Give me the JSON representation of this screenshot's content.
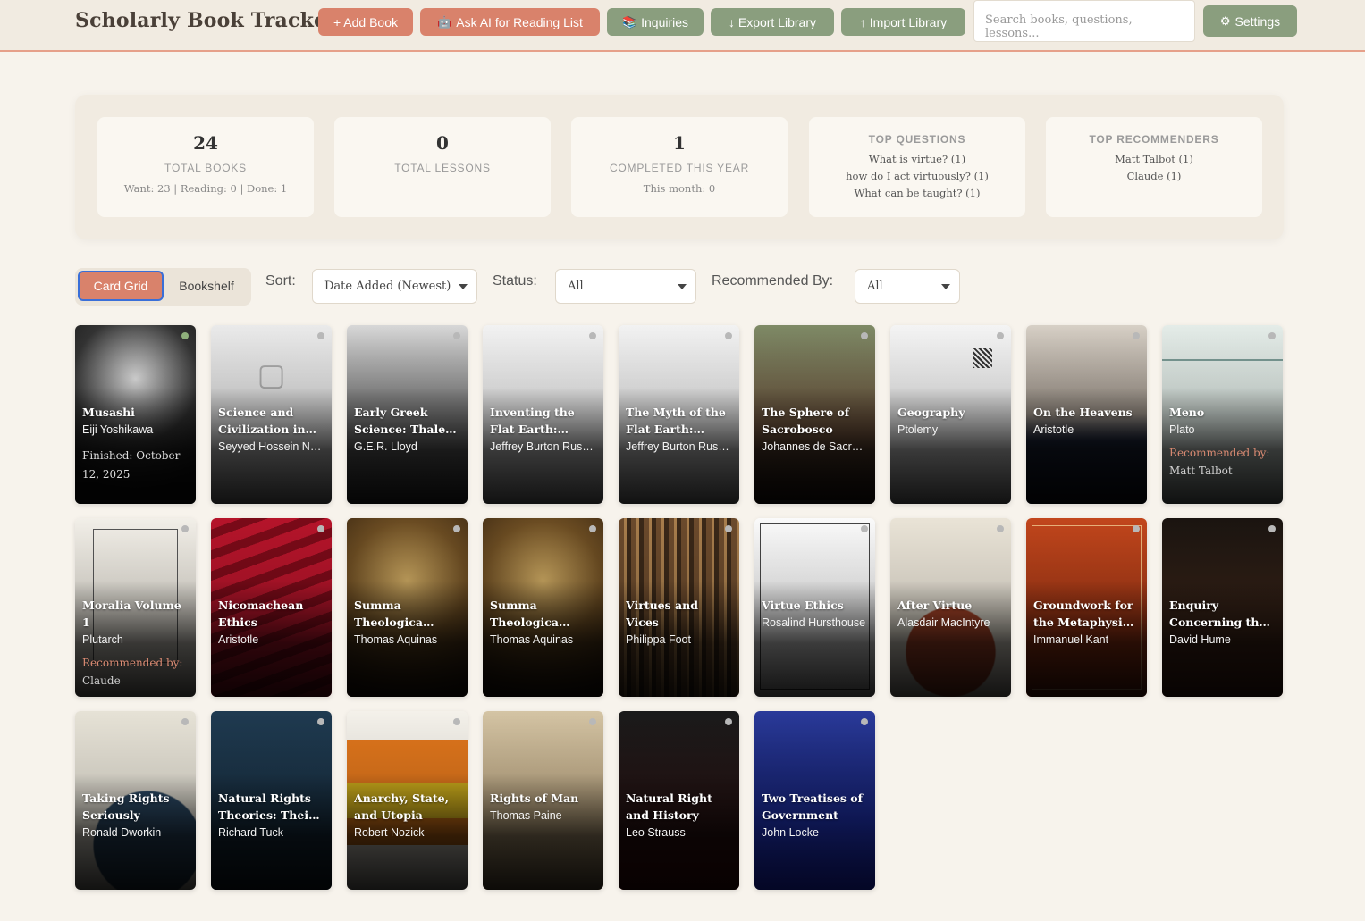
{
  "header": {
    "title": "Scholarly Book Tracker",
    "add_book": "+ Add Book",
    "ask_ai": "Ask AI for Reading List",
    "inquiries": "Inquiries",
    "export": "↓ Export Library",
    "import": "↑ Import Library",
    "search_placeholder": "Search books, questions, lessons...",
    "settings": "Settings"
  },
  "stats": {
    "total_books": {
      "value": "24",
      "label": "Total Books",
      "sub": "Want: 23 | Reading: 0 | Done: 1"
    },
    "total_lessons": {
      "value": "0",
      "label": "Total Lessons"
    },
    "completed": {
      "value": "1",
      "label": "Completed This Year",
      "sub": "This month: 0"
    },
    "top_questions": {
      "label": "Top Questions",
      "items": [
        "What is virtue? (1)",
        "how do I act virtuously? (1)",
        "What can be taught? (1)"
      ]
    },
    "top_recommenders": {
      "label": "Top Recommenders",
      "items": [
        "Matt Talbot (1)",
        "Claude (1)"
      ]
    }
  },
  "controls": {
    "view_card_grid": "Card Grid",
    "view_bookshelf": "Bookshelf",
    "sort_label": "Sort:",
    "sort_value": "Date Added (Newest)",
    "status_label": "Status:",
    "status_value": "All",
    "recommended_label": "Recommended By:",
    "recommended_value": "All"
  },
  "colors": {
    "accent_salmon": "#d9826b",
    "accent_green": "#8a9e7e",
    "background": "#f7f3ec"
  },
  "books": [
    {
      "title": "Musashi",
      "author": "Eiji Yoshikawa",
      "finished": "Finished: October 12, 2025",
      "status": "done"
    },
    {
      "title": "Science and Civilization in Islam",
      "author": "Seyyed Hossein Nasr"
    },
    {
      "title": "Early Greek Science: Thales to Aristotle",
      "author": "G.E.R. Lloyd"
    },
    {
      "title": "Inventing the Flat Earth: Columbus and Modern Historians",
      "author": "Jeffrey Burton Russell"
    },
    {
      "title": "The Myth of the Flat Earth: Studies in History",
      "author": "Jeffrey Burton Russell"
    },
    {
      "title": "The Sphere of Sacrobosco",
      "author": "Johannes de Sacrobosco"
    },
    {
      "title": "Geography",
      "author": "Ptolemy"
    },
    {
      "title": "On the Heavens",
      "author": "Aristotle"
    },
    {
      "title": "Meno",
      "author": "Plato",
      "rec_label": "Recommended by:",
      "rec_name": "Matt Talbot"
    },
    {
      "title": "Moralia Volume 1",
      "author": "Plutarch",
      "rec_label": "Recommended by:",
      "rec_name": "Claude"
    },
    {
      "title": "Nicomachean Ethics",
      "author": "Aristotle"
    },
    {
      "title": "Summa Theologica (Secunda Secundae)",
      "author": "Thomas Aquinas"
    },
    {
      "title": "Summa Theologica (Prima Secundae)",
      "author": "Thomas Aquinas"
    },
    {
      "title": "Virtues and Vices",
      "author": "Philippa Foot"
    },
    {
      "title": "Virtue Ethics",
      "author": "Rosalind Hursthouse"
    },
    {
      "title": "After Virtue",
      "author": "Alasdair MacIntyre"
    },
    {
      "title": "Groundwork for the Metaphysics of Morals",
      "author": "Immanuel Kant"
    },
    {
      "title": "Enquiry Concerning the Principles of Morals",
      "author": "David Hume"
    },
    {
      "title": "Taking Rights Seriously",
      "author": "Ronald Dworkin"
    },
    {
      "title": "Natural Rights Theories: Their Origin and Development",
      "author": "Richard Tuck"
    },
    {
      "title": "Anarchy, State, and Utopia",
      "author": "Robert Nozick"
    },
    {
      "title": "Rights of Man",
      "author": "Thomas Paine"
    },
    {
      "title": "Natural Right and History",
      "author": "Leo Strauss"
    },
    {
      "title": "Two Treatises of Government",
      "author": "John Locke"
    }
  ]
}
